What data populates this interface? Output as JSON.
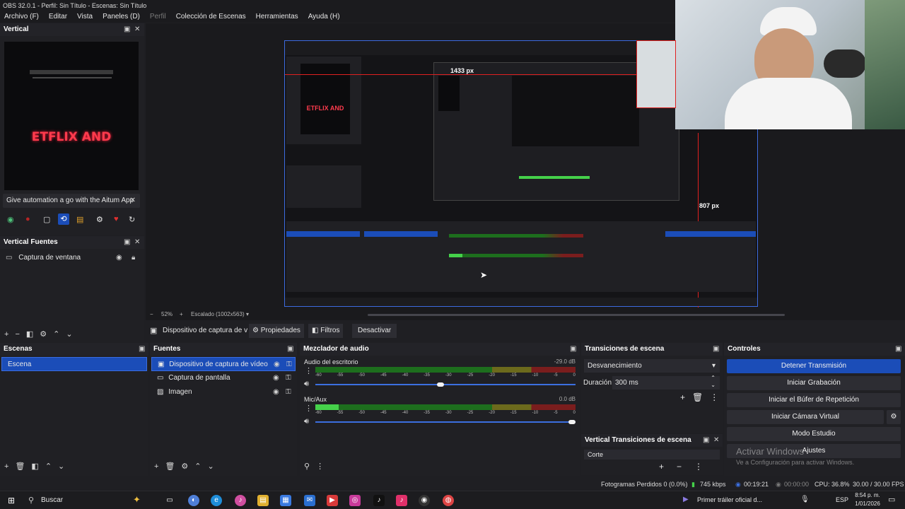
{
  "window": {
    "title": "OBS 32.0.1 - Perfil: Sin Título - Escenas: Sin Título"
  },
  "menu": [
    "Archivo (F)",
    "Editar",
    "Vista",
    "Paneles (D)",
    "Perfil",
    "Colección de Escenas",
    "Herramientas",
    "Ayuda (H)"
  ],
  "vertical_dock": {
    "title": "Vertical",
    "preview_text": "ETFLIX AND",
    "ad_text": "Give automation a go with the Aitum App"
  },
  "vertical_sources": {
    "title": "Vertical Fuentes",
    "items": [
      "Captura de ventana"
    ]
  },
  "preview": {
    "zoom": "52%",
    "scale_label": "Escalado (1002x563)",
    "measure_top": "1433 px",
    "measure_right": "807 px"
  },
  "source_toolbar": {
    "source_name": "Dispositivo de captura de v",
    "properties": "Propiedades",
    "filters": "Filtros",
    "deactivate": "Desactivar"
  },
  "scenes": {
    "title": "Escenas",
    "items": [
      "Escena"
    ]
  },
  "sources": {
    "title": "Fuentes",
    "items": [
      "Dispositivo de captura de vídeo",
      "Captura de pantalla",
      "Imagen"
    ]
  },
  "mixer": {
    "title": "Mezclador de audio",
    "channels": [
      {
        "name": "Audio del escritorio",
        "db": "-29.0 dB",
        "level": 0.0,
        "volume": 0.48
      },
      {
        "name": "Mic/Aux",
        "db": "0.0 dB",
        "level": 0.09,
        "volume": 1.0
      }
    ],
    "ticks": [
      "-60",
      "-55",
      "-50",
      "-45",
      "-40",
      "-35",
      "-30",
      "-25",
      "-20",
      "-15",
      "-10",
      "-5",
      "0"
    ]
  },
  "transitions": {
    "title": "Transiciones de escena",
    "selected": "Desvanecimiento",
    "duration_label": "Duración",
    "duration_value": "300 ms"
  },
  "vertical_transitions": {
    "title": "Vertical Transiciones de escena",
    "selected": "Corte"
  },
  "controls": {
    "title": "Controles",
    "buttons": [
      "Detener Transmisión",
      "Iniciar Grabación",
      "Iniciar el Búfer de Repetición",
      "Iniciar Cámara Virtual",
      "Modo Estudio",
      "Ajustes"
    ]
  },
  "watermark": {
    "line1": "Activar Windows",
    "line2": "Ve a Configuración para activar Windows."
  },
  "status": {
    "dropped": "Fotogramas Perdidos 0 (0.0%)",
    "bitrate": "745 kbps",
    "stream_time": "00:19:21",
    "rec_time": "00:00:00",
    "cpu": "CPU: 36.8%",
    "fps": "30.00 / 30.00 FPS"
  },
  "taskbar": {
    "search": "Buscar",
    "media": "Primer tráiler oficial d...",
    "lang": "ESP",
    "time": "8:54 p. m.",
    "date": "1/01/2026"
  },
  "colors": {
    "accent": "#1b4db8",
    "background": "#1f1f23",
    "panel": "#202024",
    "meter_green": "#45d14a"
  }
}
